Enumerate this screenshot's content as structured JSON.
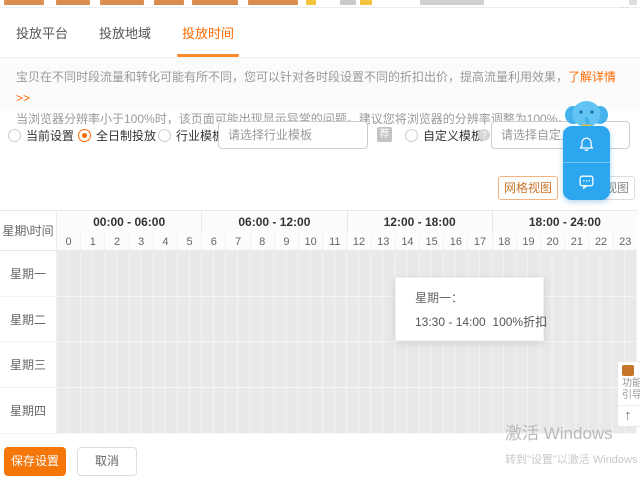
{
  "colors": {
    "accent": "#ff6a00",
    "assistant_blue": "#2ba6ef",
    "grid_gray": "#e9e9e9",
    "save_orange": "#f5770a"
  },
  "window": {
    "close_icon": "×"
  },
  "tabs": [
    {
      "label": "投放平台",
      "active": false
    },
    {
      "label": "投放地域",
      "active": false
    },
    {
      "label": "投放时间",
      "active": true
    }
  ],
  "notice": {
    "line1": "宝贝在不同时段流量和转化可能有所不同，您可以针对各时段设置不同的折扣出价，提高流量利用效果，",
    "line1_link": "了解详情 >>",
    "line2": "当浏览器分辨率小于100%时，该页面可能出现显示异常的问题。建议您将浏览器的分辨率调整为100%。"
  },
  "options": {
    "radio_current": "当前设置",
    "radio_fulltime": "全日制投放",
    "radio_industry": "行业模板:",
    "radio_custom": "自定义模板:",
    "industry_placeholder": "请选择行业模板",
    "industry_badge": "荐",
    "custom_placeholder": "请选择自定义模板",
    "help_glyph": "?"
  },
  "view_toggle": {
    "grid": "网格视图",
    "list": "列表视图"
  },
  "schedule": {
    "corner": "星期\\时间",
    "ranges": [
      "00:00 - 06:00",
      "06:00 - 12:00",
      "12:00 - 18:00",
      "18:00 - 24:00"
    ],
    "hours": [
      "0",
      "1",
      "2",
      "3",
      "4",
      "5",
      "6",
      "7",
      "8",
      "9",
      "10",
      "11",
      "12",
      "13",
      "14",
      "15",
      "16",
      "17",
      "18",
      "19",
      "20",
      "21",
      "22",
      "23"
    ],
    "days": [
      "星期一",
      "星期二",
      "星期三",
      "星期四"
    ],
    "tooltip_title": "星期一：",
    "tooltip_text": "13:30 - 14:00  100%折扣"
  },
  "footer": {
    "save": "保存设置",
    "cancel": "取消"
  },
  "watermark": {
    "line1": "激活 Windows",
    "line2": "转到\"设置\"以激活 Windows"
  },
  "side_panel": {
    "label_top": "功能",
    "label_bottom": "引导",
    "up_arrow": "↑"
  }
}
